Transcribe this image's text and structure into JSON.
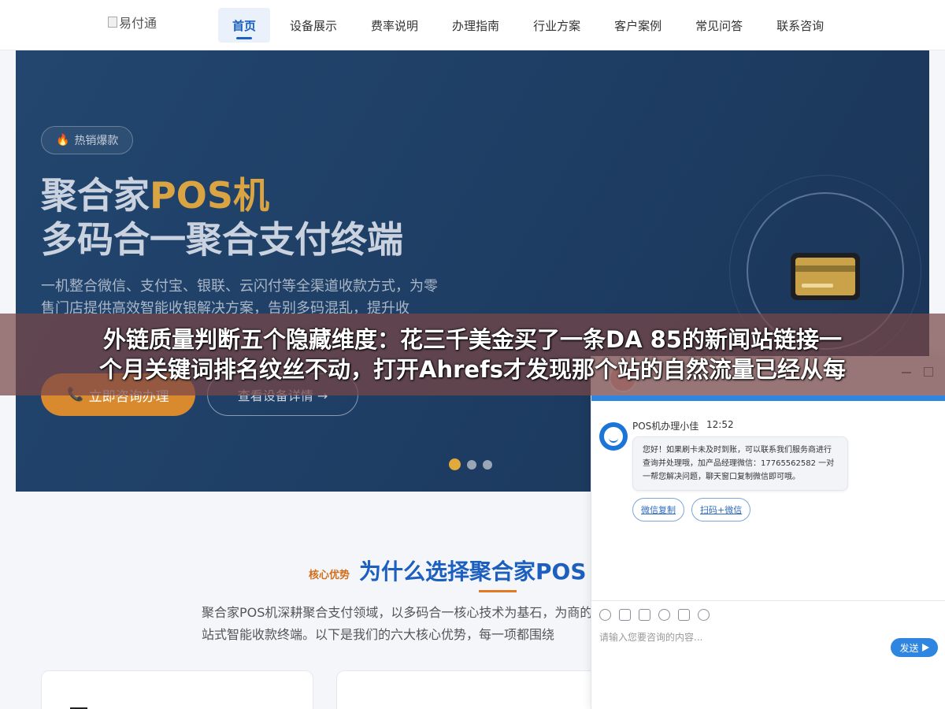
{
  "header": {
    "logo_alt": "易付通",
    "nav": [
      "首页",
      "设备展示",
      "费率说明",
      "办理指南",
      "行业方案",
      "客户案例",
      "常见问答",
      "联系咨询"
    ]
  },
  "hero": {
    "badge": "热销爆款",
    "title_part1": "聚合家",
    "title_part2": "POS机",
    "title_line2": "多码合一聚合支付终端",
    "desc": "一机整合微信、支付宝、银联、云闪付等全渠道收款方式，为零售门店提供高效智能收银解决方案，告别多码混乱，提升收",
    "btn_primary": "立即咨询办理",
    "btn_secondary": "查看设备详情 →",
    "slide_count": 3,
    "active_slide": 1
  },
  "overlay": {
    "line1": "外链质量判断五个隐藏维度：花三千美金买了一条DA 85的新闻站链接一",
    "line2": "个月关键词排名纹丝不动，打开Ahrefs才发现那个站的自然流量已经从每"
  },
  "section": {
    "label": "核心优势",
    "title": "为什么选择聚合家POS",
    "desc": "聚合家POS机深耕聚合支付领域，以多码合一核心技术为基石，为商的一站式智能收款终端。以下是我们的六大核心优势，每一项都围绕"
  },
  "chat": {
    "agent_name": "POS机办理小佳",
    "time": "12:52",
    "message": "您好！如果刷卡未及时到账，可以联系我们服务商进行查询并处理哦，加产品经理微信：17765562582 一对一帮您解决问题，聊天窗口复制微信即可哦。",
    "actions": [
      "微信复制",
      "扫码+微信"
    ],
    "input_placeholder": "请输入您要咨询的内容...",
    "send": "发送"
  }
}
